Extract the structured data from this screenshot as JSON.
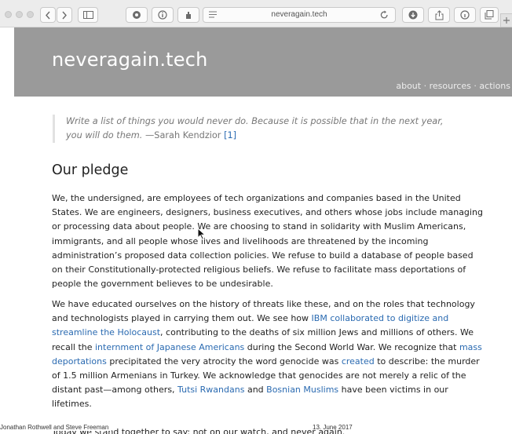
{
  "browser": {
    "url": "neveragain.tech"
  },
  "site": {
    "title": "neveragain.tech",
    "nav": {
      "about": "about",
      "resources": "resources",
      "actions": "actions",
      "separator": " · "
    }
  },
  "quote": {
    "text": "Write a list of things you would never do. Because it is possible that in the next year, you will do them.",
    "author": " —Sarah Kendzior ",
    "ref": "[1]"
  },
  "pledge": {
    "heading": "Our pledge",
    "p1": "We, the undersigned, are employees of tech organizations and companies based in the United States. We are engineers, designers, business executives, and others whose jobs include managing or processing data about people. We are choosing to stand in solidarity with Muslim Americans, immigrants, and all people whose lives and livelihoods are threatened by the incoming administration’s proposed data collection policies. We refuse to build a database of people based on their Constitutionally-protected religious beliefs. We refuse to facilitate mass deportations of people the government believes to be undesirable.",
    "p2": {
      "t1": "We have educated ourselves on the history of threats like these, and on the roles that technology and technologists played in carrying them out. We see how ",
      "link1": "IBM collaborated to digitize and streamline the Holocaust",
      "t2": ", contributing to the deaths of six million Jews and millions of others. We recall the ",
      "link2": "internment of Japanese Americans",
      "t3": " during the Second World War. We recognize that ",
      "link3": "mass deportations",
      "t4": " precipitated the very atrocity the word genocide was ",
      "link4": "created",
      "t5": " to describe: the murder of 1.5 million Armenians in Turkey. We acknowledge that genocides are not merely a relic of the distant past—among others, ",
      "link5": "Tutsi Rwandans",
      "t6": " and ",
      "link6": "Bosnian Muslims",
      "t7": " have been victims in our lifetimes."
    },
    "cut_text": "Today we stand together to say: not on our watch, and never again."
  },
  "footer": {
    "authors": "Jonathan Rothwell and Steve Freeman",
    "date": "13. June 2017"
  }
}
